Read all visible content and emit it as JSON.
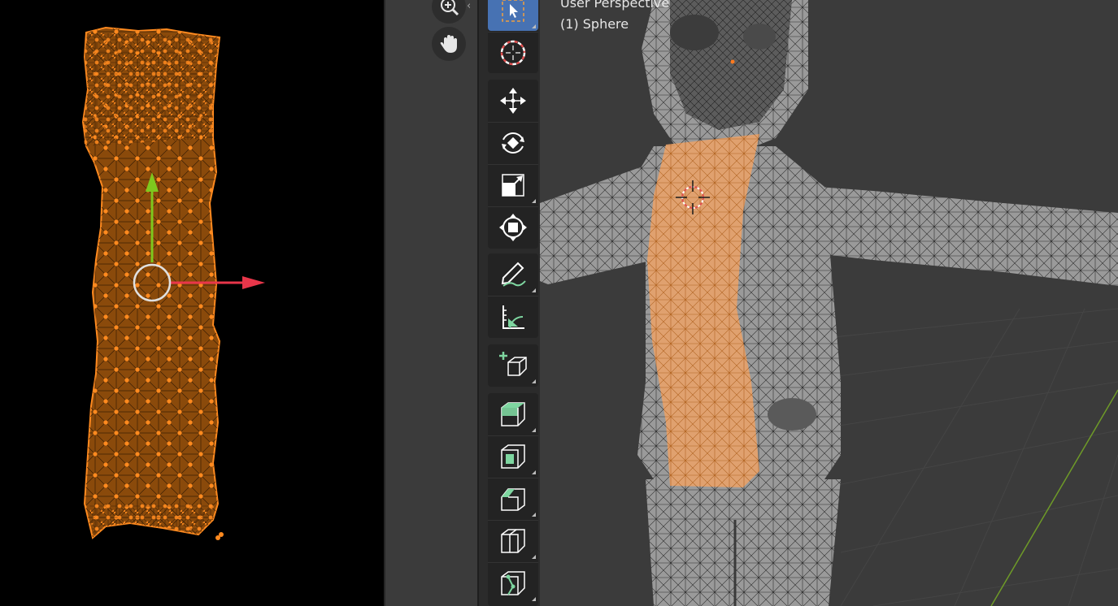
{
  "uv_editor": {
    "name": "UV Editor",
    "mesh_fill": "#8a4a0b",
    "vertex_color": "#ff8a1f",
    "gizmo": {
      "y_axis_color": "#7ec81e",
      "x_axis_color": "#e8364a",
      "center_color": "#e0e0e0"
    }
  },
  "viewport": {
    "mode_label": "User Perspective",
    "object_label": "(1) Sphere",
    "background": "#3b3b3b",
    "selection_color": "#f0a060",
    "y_axis_line_color": "#6e9a28",
    "navigation": [
      {
        "name": "zoom",
        "icon": "magnifier-zoom-icon"
      },
      {
        "name": "pan",
        "icon": "hand-pan-icon"
      }
    ],
    "tools": [
      {
        "group": "select",
        "name": "Select Box",
        "icon": "select-box-icon",
        "active": true
      },
      {
        "group": "select",
        "name": "Cursor",
        "icon": "cursor-icon",
        "active": false
      },
      {
        "group": "transform",
        "name": "Move",
        "icon": "move-icon",
        "active": false
      },
      {
        "group": "transform",
        "name": "Rotate",
        "icon": "rotate-icon",
        "active": false
      },
      {
        "group": "transform",
        "name": "Scale",
        "icon": "scale-icon",
        "active": false
      },
      {
        "group": "transform",
        "name": "Transform",
        "icon": "transform-icon",
        "active": false
      },
      {
        "group": "annotate",
        "name": "Annotate",
        "icon": "annotate-pencil-icon",
        "active": false
      },
      {
        "group": "annotate",
        "name": "Measure",
        "icon": "measure-ruler-icon",
        "active": false
      },
      {
        "group": "add",
        "name": "Add Cube",
        "icon": "add-cube-icon",
        "active": false
      },
      {
        "group": "mesh",
        "name": "Extrude Region",
        "icon": "extrude-icon",
        "active": false
      },
      {
        "group": "mesh",
        "name": "Inset Faces",
        "icon": "inset-icon",
        "active": false
      },
      {
        "group": "mesh",
        "name": "Bevel",
        "icon": "bevel-icon",
        "active": false
      },
      {
        "group": "mesh",
        "name": "Loop Cut",
        "icon": "loop-cut-icon",
        "active": false
      },
      {
        "group": "mesh",
        "name": "Knife",
        "icon": "knife-icon",
        "active": false
      }
    ]
  }
}
